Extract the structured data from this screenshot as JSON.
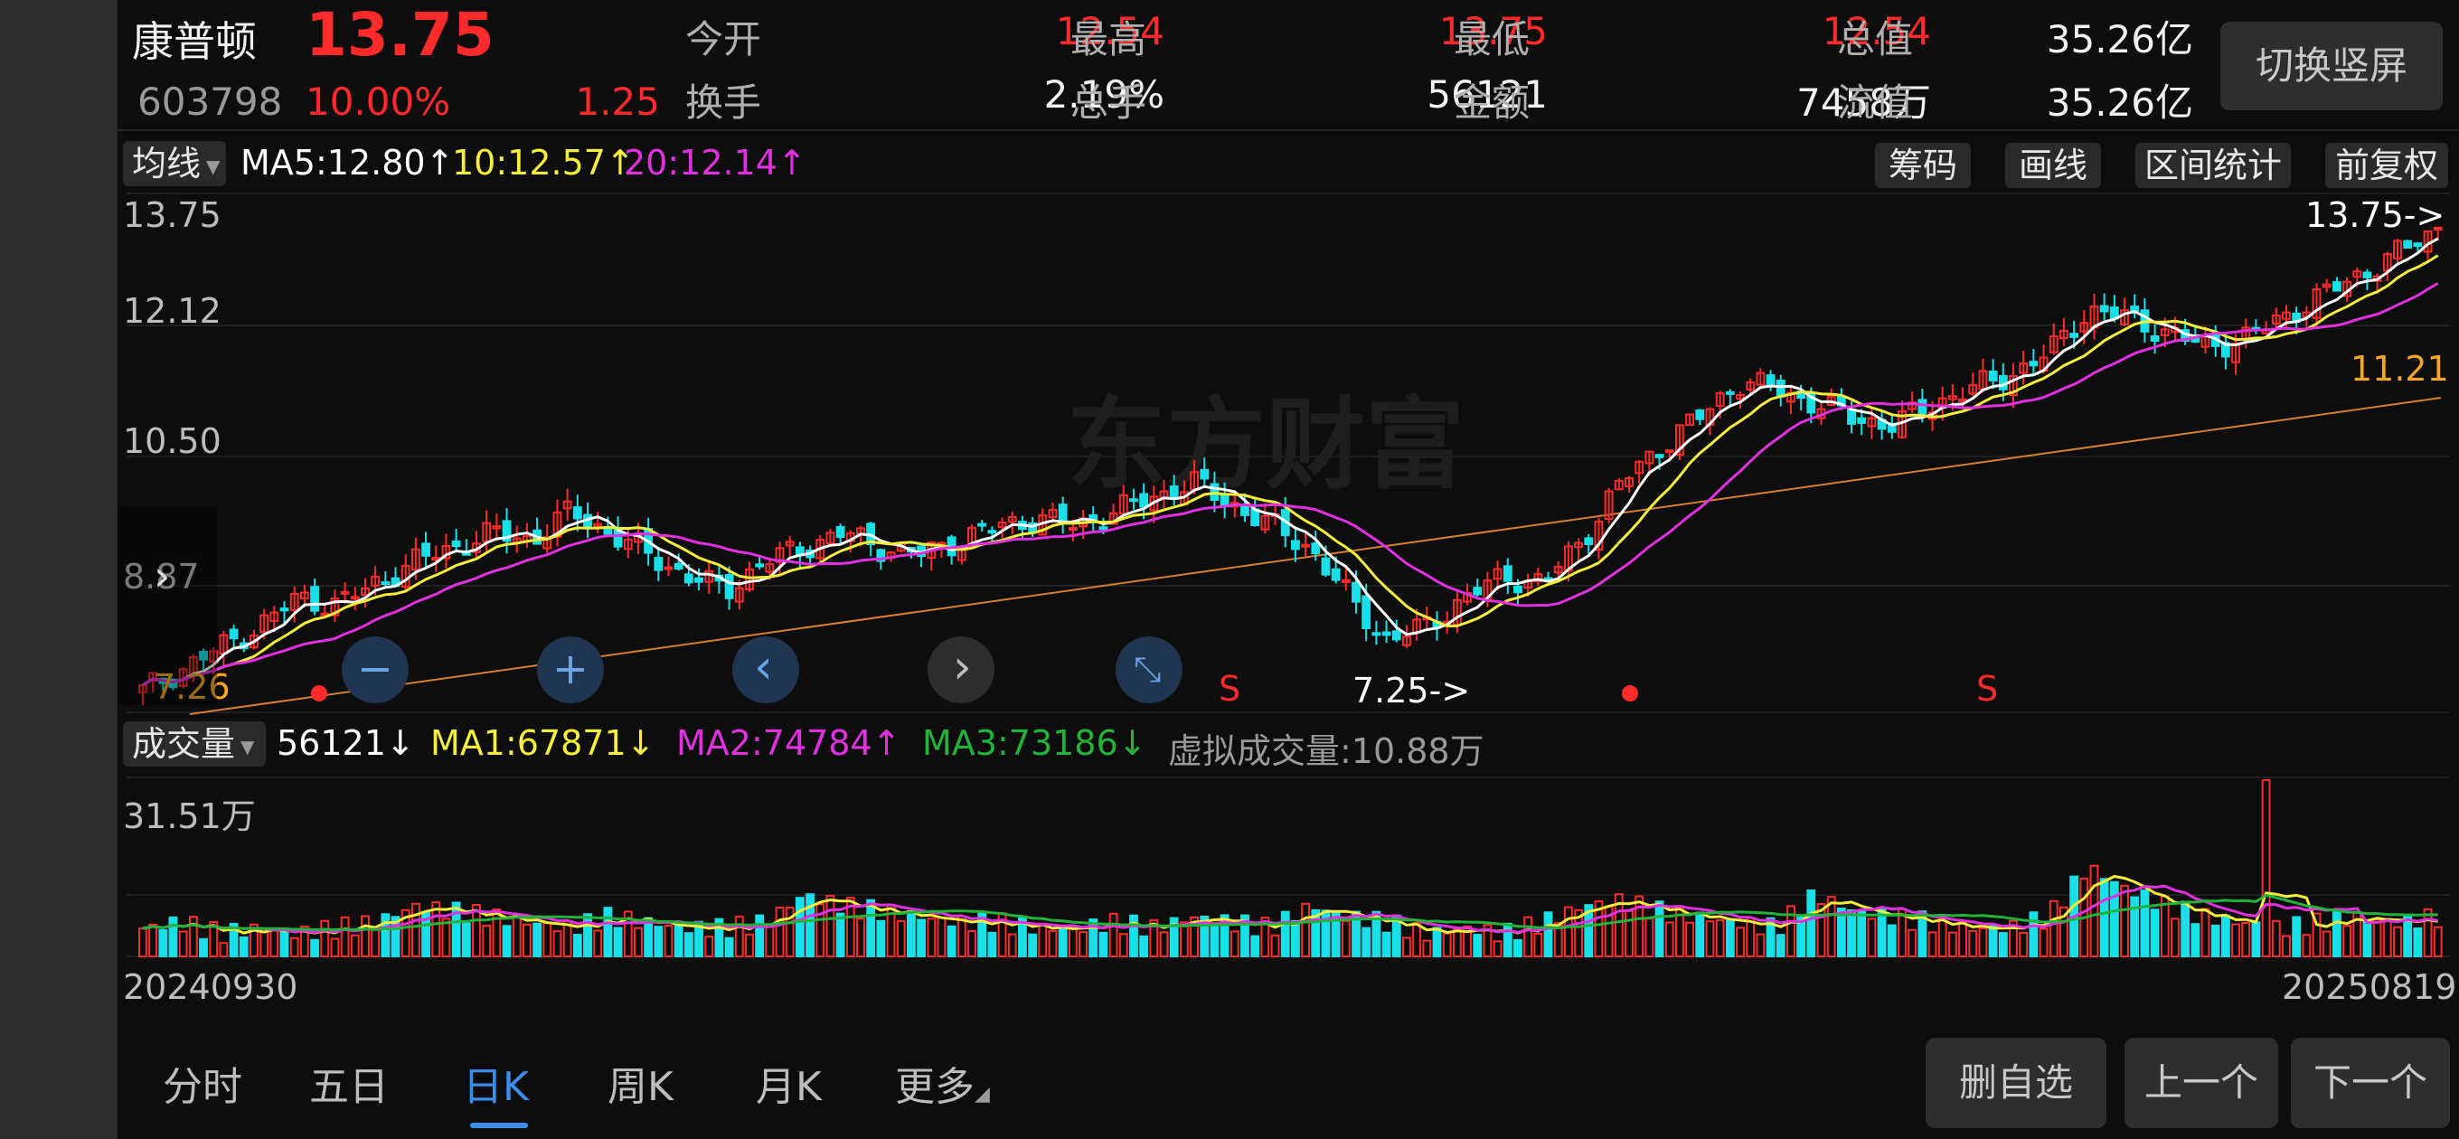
{
  "header": {
    "name": "康普顿",
    "price": "13.75",
    "code": "603798",
    "change_pct": "10.00%",
    "change": "1.25",
    "quotes": [
      {
        "label": "今开",
        "value": "12.54",
        "color": "red"
      },
      {
        "label": "最高",
        "value": "13.75",
        "color": "red"
      },
      {
        "label": "最低",
        "value": "12.54",
        "color": "red"
      },
      {
        "label": "总值",
        "value": "35.26亿",
        "color": "white"
      },
      {
        "label": "换手",
        "value": "2.19%",
        "color": "white"
      },
      {
        "label": "总手",
        "value": "56121",
        "color": "white"
      },
      {
        "label": "金额",
        "value": "7458万",
        "color": "white"
      },
      {
        "label": "流值",
        "value": "35.26亿",
        "color": "white"
      }
    ],
    "switch_label": "切换竖屏"
  },
  "ma_bar": {
    "dropdown": "均线",
    "ma5": "MA5:12.80",
    "ma10": "10:12.57",
    "ma20": "20:12.14",
    "arrow_up": "↑",
    "tools": [
      "筹码",
      "画线",
      "区间统计",
      "前复权"
    ]
  },
  "price_chart": {
    "y_labels": [
      "13.75",
      "12.12",
      "10.50",
      "8.87"
    ],
    "max_marker": "13.75->",
    "min_marker": "7.25->",
    "left_low": "7.26",
    "right_level": "11.21",
    "sell_marks": [
      "S",
      "S"
    ],
    "watermark": "东方财富"
  },
  "volume_bar": {
    "dropdown": "成交量",
    "vol": "56121",
    "ma1": "MA1:67871",
    "ma2": "MA2:74784",
    "ma3": "MA3:73186",
    "virtual": "虚拟成交量:10.88万",
    "arrow_down": "↓",
    "arrow_up": "↑",
    "max_label": "31.51万",
    "date_start": "20240930",
    "date_end": "20250819"
  },
  "tabs": {
    "items": [
      "分时",
      "五日",
      "日K",
      "周K",
      "月K",
      "更多"
    ],
    "active": "日K",
    "buttons": [
      "删自选",
      "上一个",
      "下一个"
    ]
  },
  "colors": {
    "up": "#ff2b2b",
    "down": "#19e0e8",
    "ma5": "#ffffff",
    "ma10": "#f5ee3a",
    "ma20": "#e030e0",
    "ma3": "#22b33a",
    "active_tab": "#3b8eea"
  },
  "chart_data": {
    "type": "candlestick",
    "x_range": [
      "20240930",
      "20250819"
    ],
    "price_range": [
      7.25,
      13.75
    ],
    "last": {
      "open": 12.54,
      "high": 13.75,
      "low": 12.54,
      "close": 13.75,
      "volume": 56121
    },
    "ma": {
      "MA5": 12.8,
      "MA10": 12.57,
      "MA20": 12.14
    },
    "volume_ma": {
      "MA1": 67871,
      "MA2": 74784,
      "MA3": 73186
    },
    "volume_max": "31.51万",
    "close_path": [
      7.3,
      7.6,
      7.9,
      8.2,
      8.6,
      8.5,
      8.8,
      9.1,
      9.3,
      9.5,
      9.4,
      9.8,
      9.5,
      9.2,
      8.9,
      8.7,
      9.1,
      9.3,
      9.5,
      9.3,
      9.2,
      9.4,
      9.6,
      9.7,
      9.6,
      9.8,
      10.0,
      10.2,
      9.9,
      9.6,
      9.3,
      8.6,
      8.0,
      8.2,
      8.6,
      8.9,
      8.8,
      9.4,
      10.2,
      10.7,
      11.1,
      11.6,
      11.5,
      11.3,
      11.1,
      11.0,
      11.3,
      11.5,
      11.7,
      12.0,
      12.6,
      12.5,
      12.3,
      12.1,
      12.2,
      12.5,
      12.8,
      13.1,
      13.4,
      13.75
    ],
    "volume_path": [
      5,
      6,
      4,
      5,
      4,
      5,
      6,
      9,
      8,
      7,
      6,
      5,
      7,
      6,
      5,
      5,
      6,
      11,
      9,
      8,
      7,
      6,
      6,
      5,
      5,
      6,
      5,
      7,
      6,
      5,
      9,
      7,
      6,
      4,
      5,
      4,
      6,
      9,
      10,
      8,
      7,
      6,
      5,
      11,
      8,
      7,
      6,
      5,
      5,
      7,
      16,
      12,
      9,
      7,
      6,
      5,
      6,
      7,
      6,
      7
    ]
  }
}
